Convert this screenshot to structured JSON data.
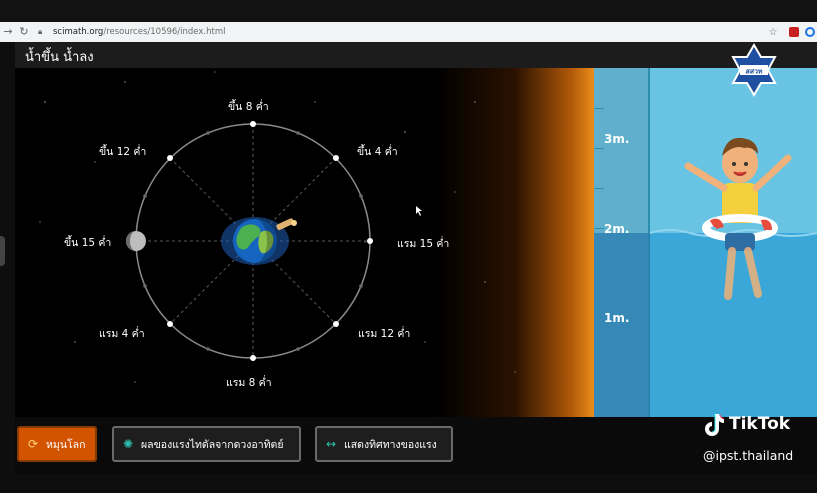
{
  "browser": {
    "url_host": "scimath.org",
    "url_path": "/resources/10596/index.html"
  },
  "app": {
    "title": "น้ำขึ้น น้ำลง",
    "logo_text": "สสวท"
  },
  "orbit": {
    "labels": {
      "top": "ขึ้น 8 ค่ำ",
      "top_left": "ขึ้น 12 ค่ำ",
      "top_right": "ขึ้น 4 ค่ำ",
      "left": "ขึ้น 15 ค่ำ",
      "right": "แรม 15 ค่ำ",
      "bottom_left": "แรม 4 ค่ำ",
      "bottom_right": "แรม 12 ค่ำ",
      "bottom": "แรม 8 ค่ำ"
    }
  },
  "water_gauge": {
    "marks": [
      "3m.",
      "2m.",
      "1m."
    ]
  },
  "controls": {
    "rotate_label": "หมุนโลก",
    "sun_effect_label": "ผลของแรงไทดัลจากดวงอาทิตย์",
    "force_direction_label": "แสดงทิศทางของแรง"
  },
  "watermark": {
    "name": "TikTok",
    "handle": "@ipst.thailand"
  },
  "colors": {
    "rotate_button": "#d35400",
    "water": "#3aa7d8",
    "sky": "#69c4e4"
  }
}
